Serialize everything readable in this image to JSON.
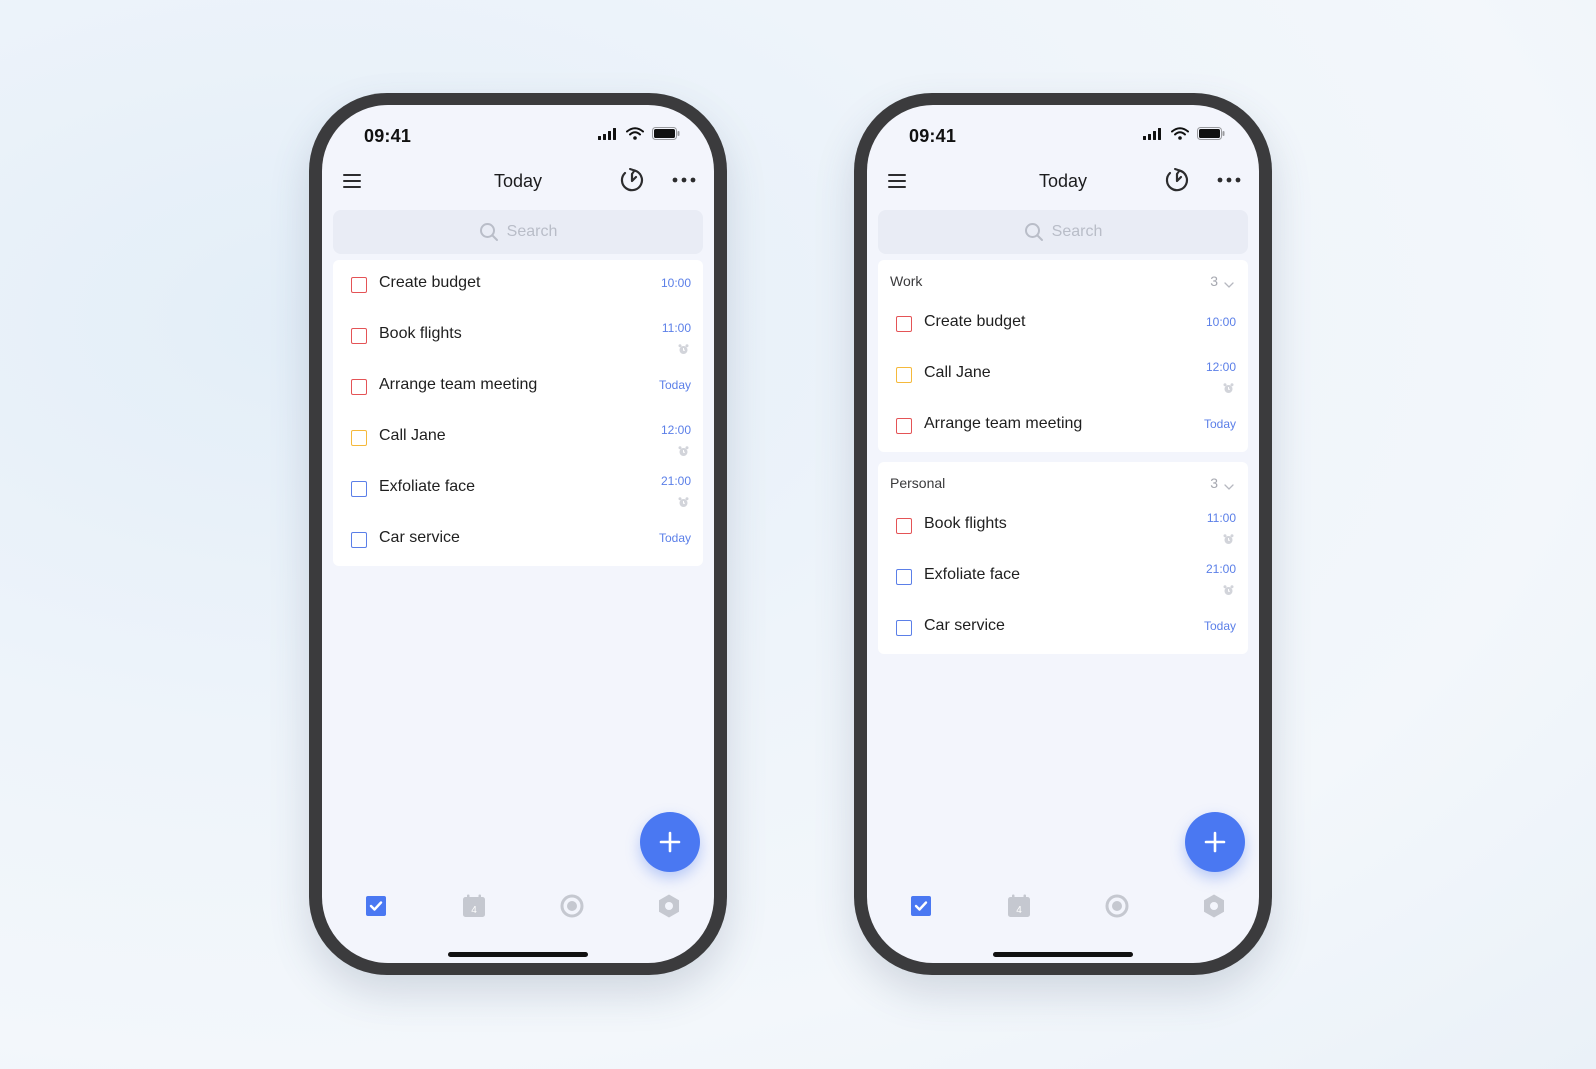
{
  "colors": {
    "accent": "#4a78f2",
    "priority_high": "#e45356",
    "priority_medium": "#f5b93b",
    "priority_low": "#5b7fe8",
    "due_text": "#5b7fe8",
    "icon_muted": "#c5c8d0"
  },
  "screens": [
    {
      "status": {
        "time": "09:41"
      },
      "header": {
        "title": "Today",
        "menu_icon": "hamburger-icon",
        "focus_icon": "pomodoro-timer-icon",
        "more_icon": "more-horizontal-icon"
      },
      "search": {
        "placeholder": "Search",
        "icon": "search-icon"
      },
      "tasks": [
        {
          "title": "Create budget",
          "due": "10:00",
          "priority": "high",
          "alarm": false
        },
        {
          "title": "Book flights",
          "due": "11:00",
          "priority": "high",
          "alarm": true
        },
        {
          "title": "Arrange team meeting",
          "due": "Today",
          "priority": "high",
          "alarm": false
        },
        {
          "title": "Call Jane",
          "due": "12:00",
          "priority": "medium",
          "alarm": true
        },
        {
          "title": "Exfoliate face",
          "due": "21:00",
          "priority": "low",
          "alarm": true
        },
        {
          "title": "Car service",
          "due": "Today",
          "priority": "low",
          "alarm": false
        }
      ],
      "fab_icon": "plus-icon",
      "tabs": [
        {
          "name": "tasks",
          "icon": "checkbox-checked-icon",
          "active": true
        },
        {
          "name": "calendar",
          "icon": "calendar-icon",
          "day": "4",
          "active": false
        },
        {
          "name": "habit",
          "icon": "circle-ring-icon",
          "active": false
        },
        {
          "name": "settings",
          "icon": "hexagon-gear-icon",
          "active": false
        }
      ]
    },
    {
      "status": {
        "time": "09:41"
      },
      "header": {
        "title": "Today",
        "menu_icon": "hamburger-icon",
        "focus_icon": "pomodoro-timer-icon",
        "more_icon": "more-horizontal-icon"
      },
      "search": {
        "placeholder": "Search",
        "icon": "search-icon"
      },
      "groups": [
        {
          "name": "Work",
          "count": "3",
          "tasks": [
            {
              "title": "Create budget",
              "due": "10:00",
              "priority": "high",
              "alarm": false
            },
            {
              "title": "Call Jane",
              "due": "12:00",
              "priority": "medium",
              "alarm": true
            },
            {
              "title": "Arrange team meeting",
              "due": "Today",
              "priority": "high",
              "alarm": false
            }
          ]
        },
        {
          "name": "Personal",
          "count": "3",
          "tasks": [
            {
              "title": "Book flights",
              "due": "11:00",
              "priority": "high",
              "alarm": true
            },
            {
              "title": "Exfoliate face",
              "due": "21:00",
              "priority": "low",
              "alarm": true
            },
            {
              "title": "Car service",
              "due": "Today",
              "priority": "low",
              "alarm": false
            }
          ]
        }
      ],
      "fab_icon": "plus-icon",
      "tabs": [
        {
          "name": "tasks",
          "icon": "checkbox-checked-icon",
          "active": true
        },
        {
          "name": "calendar",
          "icon": "calendar-icon",
          "day": "4",
          "active": false
        },
        {
          "name": "habit",
          "icon": "circle-ring-icon",
          "active": false
        },
        {
          "name": "settings",
          "icon": "hexagon-gear-icon",
          "active": false
        }
      ]
    }
  ]
}
